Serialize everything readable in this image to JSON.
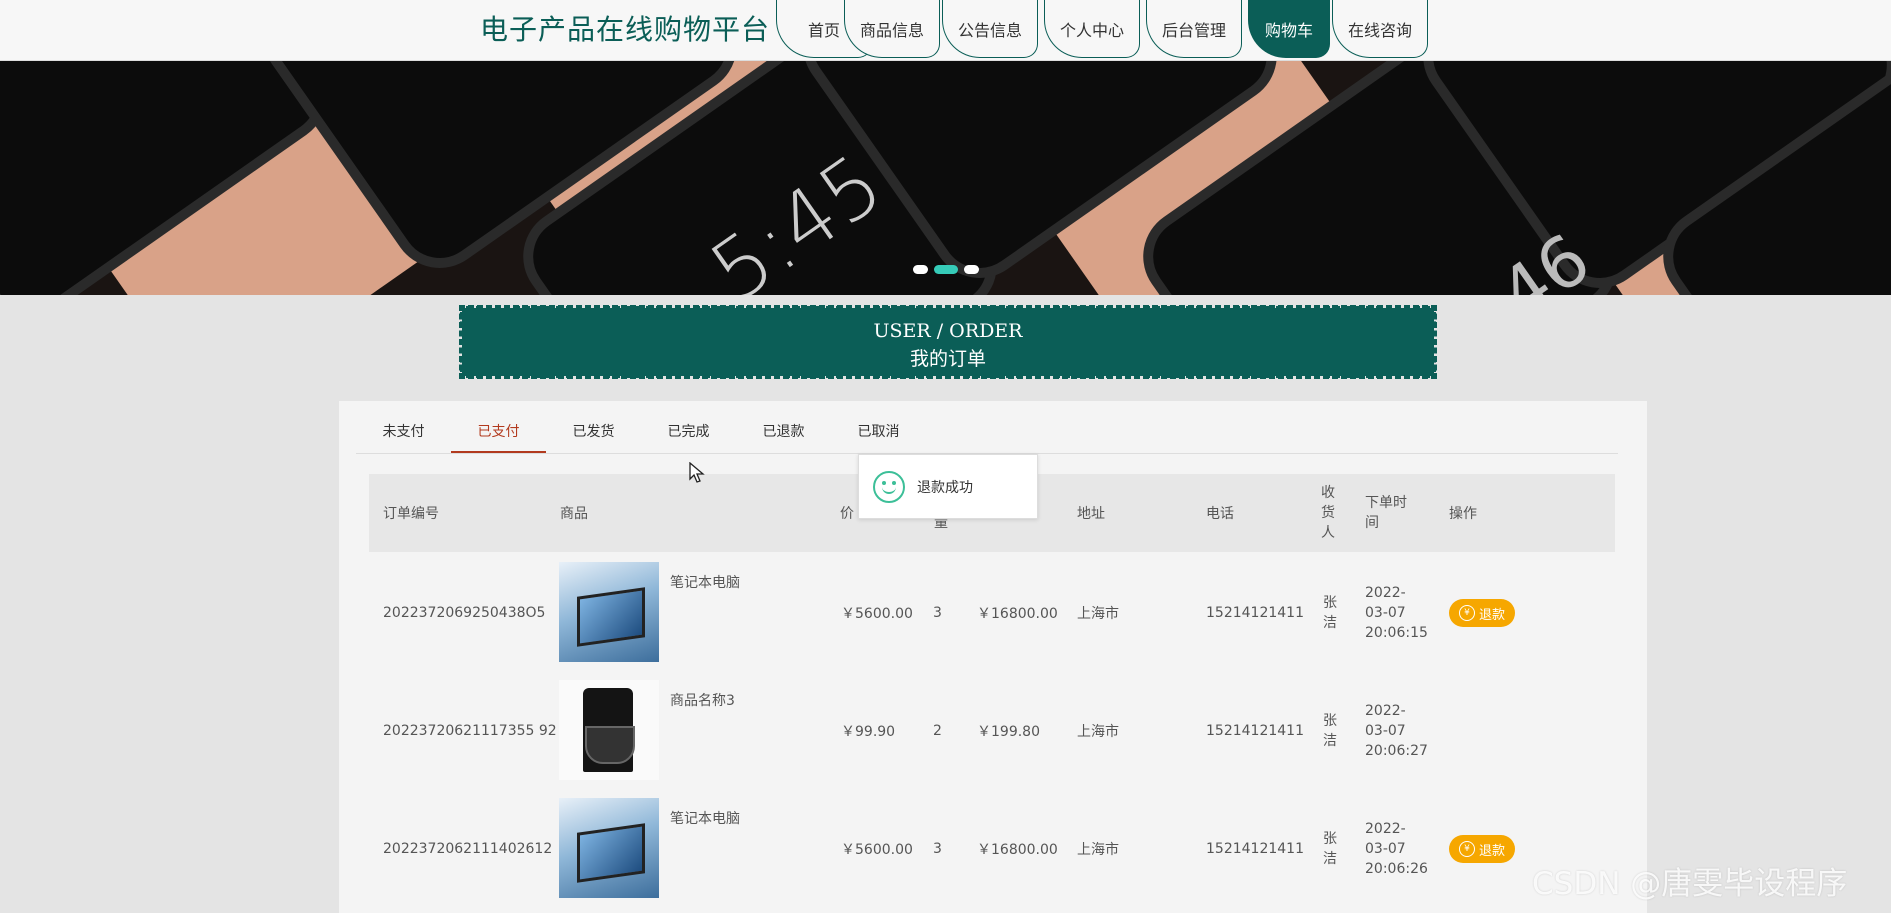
{
  "header": {
    "site_title": "电子产品在线购物平台",
    "nav": [
      "首页",
      "商品信息",
      "公告信息",
      "个人中心",
      "后台管理",
      "购物车",
      "在线咨询"
    ],
    "active_nav": "购物车"
  },
  "banner": {
    "clock_text": "5:45",
    "clock2_text": "46",
    "slide_count": 3,
    "active_slide": 2
  },
  "order_section": {
    "title_en": "USER / ORDER",
    "title_cn": "我的订单"
  },
  "tabs": [
    "未支付",
    "已支付",
    "已发货",
    "已完成",
    "已退款",
    "已取消"
  ],
  "active_tab": "已支付",
  "table": {
    "headers": {
      "order_no": "订单编号",
      "product": "商品",
      "price": "价",
      "qty": "量",
      "address": "地址",
      "phone": "电话",
      "receiver": [
        "收",
        "货",
        "人"
      ],
      "order_time": [
        "下单时",
        "间"
      ],
      "action": "操作"
    },
    "rows": [
      {
        "order_no": "2022372069250438O5",
        "product_name": "笔记本电脑",
        "thumb": "laptop",
        "price": "￥5600.00",
        "qty": "3",
        "total": "￥16800.00",
        "address": "上海市",
        "phone": "15214121411",
        "receiver": [
          "张",
          "洁"
        ],
        "time": [
          "2022-",
          "03-07",
          "20:06:15"
        ],
        "action": "退款"
      },
      {
        "order_no": "20223720621117355 92",
        "product_name": "商品名称3",
        "thumb": "coffee",
        "price": "￥99.90",
        "qty": "2",
        "total": "￥199.80",
        "address": "上海市",
        "phone": "15214121411",
        "receiver": [
          "张",
          "洁"
        ],
        "time": [
          "2022-",
          "03-07",
          "20:06:27"
        ],
        "action": ""
      },
      {
        "order_no": "2022372062111402612",
        "product_name": "笔记本电脑",
        "thumb": "laptop",
        "price": "￥5600.00",
        "qty": "3",
        "total": "￥16800.00",
        "address": "上海市",
        "phone": "15214121411",
        "receiver": [
          "张",
          "洁"
        ],
        "time": [
          "2022-",
          "03-07",
          "20:06:26"
        ],
        "action": "退款"
      }
    ]
  },
  "toast": {
    "message": "退款成功",
    "icon": "smile-icon"
  },
  "watermark": "CSDN @唐雯毕设程序",
  "colors": {
    "brand": "#0b5e57",
    "tab_active": "#b23a1e",
    "refund_button": "#f6a700",
    "slide_active": "#36cbb8"
  }
}
